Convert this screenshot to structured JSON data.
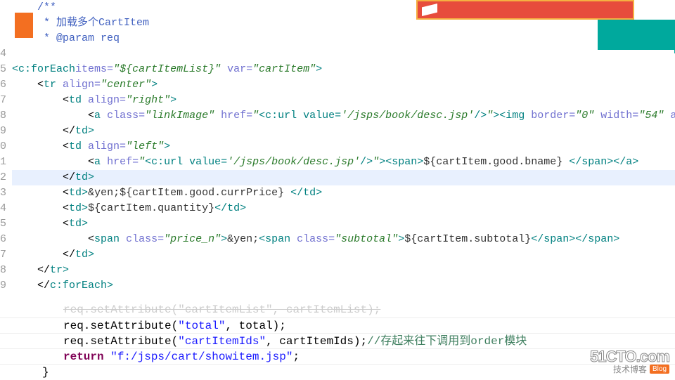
{
  "gutter": [
    "4",
    "5",
    "6",
    "7",
    "8",
    "9",
    "0",
    "1",
    "2",
    "3",
    "4",
    "5",
    "6",
    "7",
    "8",
    "9",
    ""
  ],
  "lines": {
    "l0a": "/**",
    "l0b": " * 加载多个CartItem",
    "l0c": " * @param req",
    "l1": {
      "tag": "c:forEach",
      "a1": "items=",
      "v1": "\"${cartItemList}\"",
      "a2": " var=",
      "v2": "\"cartItem\"",
      "end": ">"
    },
    "l2": {
      "pre": "    <",
      "tag": "tr",
      "a": " align=",
      "v": "\"center\"",
      "end": ">"
    },
    "l3": {
      "pre": "        <",
      "tag": "td",
      "a": " align=",
      "v": "\"right\"",
      "end": ">"
    },
    "l4": {
      "pre": "            <",
      "tag": "a",
      "a1": " class=",
      "v1": "\"linkImage\"",
      "a2": " href=",
      "v2": "\"",
      "inner": "<c:url value=",
      "v3": "'/jsps/book/desc.jsp'",
      "close": "/>",
      "v4": "\"",
      "mid": "><",
      "tag2": "img",
      "a3": " border=",
      "v5": "\"0\"",
      "a4": " width=",
      "v6": "\"54\"",
      "a5": " ali"
    },
    "l5": {
      "pre": "        </",
      "tag": "td",
      "end": ">"
    },
    "l6": {
      "pre": "        <",
      "tag": "td",
      "a": " align=",
      "v": "\"left\"",
      "end": ">"
    },
    "l7": {
      "pre": "            <",
      "tag": "a",
      "a1": " href=",
      "v1": "\"",
      "inner": "<c:url value=",
      "v2": "'/jsps/book/desc.jsp'",
      "close": "/>",
      "v3": "\"",
      "mid": "><",
      "tag2": "span",
      "end": ">",
      "txt": "${cartItem.good.bname} ",
      "closeall": "</span></a>"
    },
    "l8": {
      "pre": "        </",
      "tag": "td",
      "end": ">"
    },
    "l9": {
      "pre": "        <",
      "tag": "td",
      "end": ">",
      "txt": "&yen;${cartItem.good.currPrice} ",
      "close": "</td>"
    },
    "l10": {
      "pre": "        <",
      "tag": "td",
      "end": ">",
      "txt": "${cartItem.quantity}",
      "close": "</td>"
    },
    "l11": {
      "pre": "        <",
      "tag": "td",
      "end": ">"
    },
    "l12": {
      "pre": "            <",
      "tag": "span",
      "a1": " class=",
      "v1": "\"price_n\"",
      "end": ">",
      "txt1": "&yen;",
      "mid": "<",
      "tag2": "span",
      "a2": " class=",
      "v2": "\"subtotal\"",
      "end2": ">",
      "txt2": "${cartItem.subtotal}",
      "close": "</span></span>"
    },
    "l13": {
      "pre": "        </",
      "tag": "td",
      "end": ">"
    },
    "l14": {
      "pre": "    </",
      "tag": "tr",
      "end": ">"
    },
    "l15": {
      "pre": "    </",
      "tag": "c:forEach",
      "end": ">"
    }
  },
  "bottom": {
    "b0": "req.setAttribute(\"cartItemList\", cartItemList);",
    "b1": {
      "p1": "req.setAttribute(",
      "s": "\"total\"",
      "p2": ", total);"
    },
    "b2": {
      "p1": "req.setAttribute(",
      "s": "\"cartItemIds\"",
      "p2": ", cartItemIds);",
      "c": "//存起来往下调用到order模块"
    },
    "b3": {
      "kw": "return ",
      "s": "\"f:/jsps/cart/showitem.jsp\"",
      "p": ";"
    },
    "b4": "}"
  },
  "banner": "▬ ▬ ▬ ▬ ▬",
  "watermark": {
    "site": "51CTO.com",
    "sub": "技术博客",
    "badge": "Blog"
  }
}
